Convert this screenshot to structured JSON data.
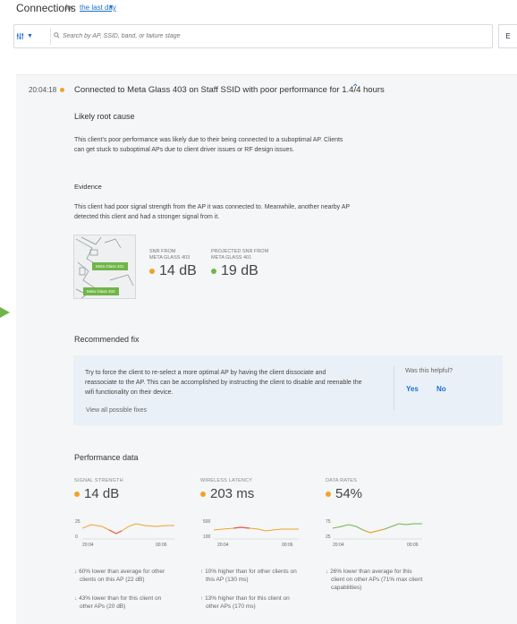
{
  "header": {
    "title": "Connections",
    "for_label": "for",
    "range_link": "the last day"
  },
  "search": {
    "placeholder": "Search by AP, SSID, band, or failure stage",
    "side_button": "E"
  },
  "event": {
    "time": "20:04:18",
    "title": "Connected to Meta Glass 403 on Staff SSID with poor performance for 1.4/4 hours"
  },
  "root_cause": {
    "heading": "Likely root cause",
    "text1": "This client's poor performance was likely due to their being connected to a suboptimal AP. Clients",
    "text2": "can get stuck to suboptimal APs due to client driver issues or RF design issues."
  },
  "evidence": {
    "heading": "Evidence",
    "text1": "This client had poor signal strength from the AP it was connected to. Meanwhile, another nearby AP",
    "text2": "detected this client and had a stronger signal from it.",
    "ap1_tag": "Meta Glass 401",
    "ap2_tag": "Meta Glass 403",
    "snr1_label1": "SNR FROM",
    "snr1_label2": "META GLASS 403",
    "snr1_value": "14 dB",
    "snr2_label1": "PROJECTED SNR FROM",
    "snr2_label2": "META GLASS 401",
    "snr2_value": "19 dB"
  },
  "fix": {
    "heading": "Recommended fix",
    "text1": "Try to force the client to re-select a more optimal AP by having the client dissociate and",
    "text2": "reassociate to the AP. This can be accomplished by instructing the client to disable and reenable the",
    "text3": "wifi functionality on their device.",
    "link": "View all possible fixes",
    "helpful_q": "Was this helpful?",
    "yes": "Yes",
    "no": "No"
  },
  "performance": {
    "heading": "Performance data",
    "metrics": [
      {
        "label": "SIGNAL STRENGTH",
        "value": "14 dB",
        "y_top": "25",
        "y_bottom": "0",
        "x_start": "20:04",
        "x_end": "00:06",
        "note1a": "60% lower than average for other",
        "note1b": "clients on this AP (22 dB)",
        "note2a": "43% lower than for this client on",
        "note2b": "other APs (20 dB)"
      },
      {
        "label": "WIRELESS LATENCY",
        "value": "203 ms",
        "y_top": "500",
        "y_bottom": "100",
        "x_start": "20:04",
        "x_end": "00:06",
        "note1a": "10% higher than for other clients on",
        "note1b": "this AP (130 ms)",
        "note2a": "13% higher than for this client on",
        "note2b": "other APs (170 ms)"
      },
      {
        "label": "DATA RATES",
        "value": "54%",
        "y_top": "75",
        "y_bottom": "25",
        "x_start": "20:04",
        "x_end": "00:06",
        "note1a": "26% lower than average for this",
        "note1b": "client on other APs (71% max client",
        "note1c": "capabilities)"
      }
    ]
  },
  "colors": {
    "accent": "#1b6fd0",
    "warn": "#f0a32a",
    "good": "#6fb548",
    "bad": "#e05a4e"
  }
}
